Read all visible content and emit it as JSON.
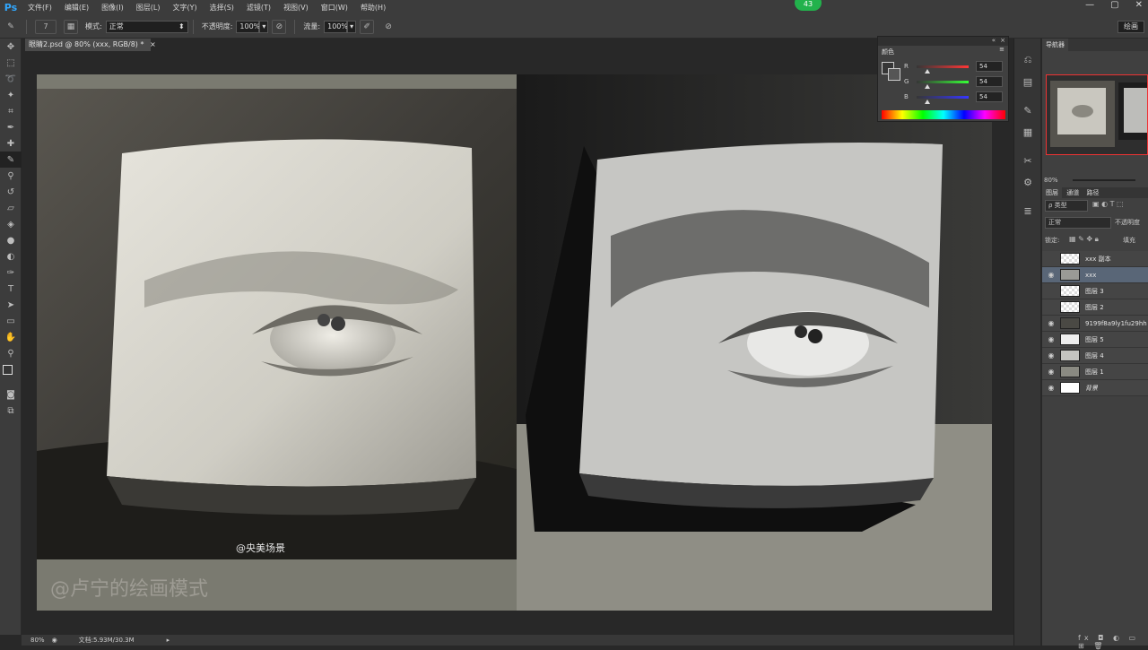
{
  "app": {
    "logo": "Ps",
    "badge": "43"
  },
  "menu": [
    "文件(F)",
    "编辑(E)",
    "图像(I)",
    "图层(L)",
    "文字(Y)",
    "选择(S)",
    "滤镜(T)",
    "视图(V)",
    "窗口(W)",
    "帮助(H)"
  ],
  "options": {
    "brush_size": "7",
    "mode_label": "模式:",
    "mode_value": "正常",
    "opacity_label": "不透明度:",
    "opacity_value": "100%",
    "flow_label": "流量:",
    "flow_value": "100%"
  },
  "workspace_button": "绘画",
  "document": {
    "tab_title": "眼睛2.psd @ 80% (xxx, RGB/8) *",
    "watermark_weibo": "@央美场景",
    "watermark_author": "@卢宁的绘画模式",
    "zoom": "80%",
    "doc_size": "文档:5.93M/30.3M"
  },
  "color_panel": {
    "title": "颜色",
    "r_label": "R",
    "r_value": "54",
    "g_label": "G",
    "g_value": "54",
    "b_label": "B",
    "b_value": "54",
    "r_fraction": 0.21,
    "g_fraction": 0.21,
    "b_fraction": 0.21
  },
  "navigator": {
    "title": "导航器",
    "zoom": "80%"
  },
  "layers_panel": {
    "tabs": [
      "图层",
      "通道",
      "路径"
    ],
    "filter_kind": "ρ 类型",
    "blend_mode": "正常",
    "opacity_label": "不透明度",
    "lock_label": "锁定:",
    "fill_label": "填充",
    "layers": [
      {
        "name": "xxx 副本",
        "visible": false,
        "selected": false
      },
      {
        "name": "xxx",
        "visible": true,
        "selected": true
      },
      {
        "name": "图层 3",
        "visible": false,
        "selected": false
      },
      {
        "name": "图层 2",
        "visible": false,
        "selected": false
      },
      {
        "name": "9199f8a9ly1fu29hh",
        "visible": true,
        "selected": false
      },
      {
        "name": "图层 5",
        "visible": true,
        "selected": false
      },
      {
        "name": "图层 4",
        "visible": true,
        "selected": false
      },
      {
        "name": "图层 1",
        "visible": true,
        "selected": false
      },
      {
        "name": "背景",
        "visible": true,
        "selected": false
      }
    ]
  },
  "colors": {
    "accent": "#31a8ff",
    "badge": "#22b24c",
    "selected_layer": "#596677"
  }
}
